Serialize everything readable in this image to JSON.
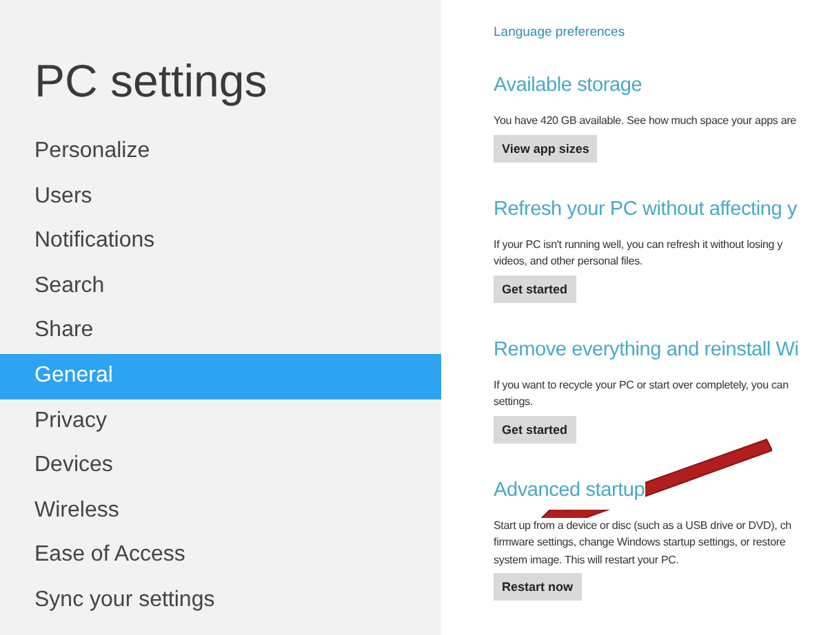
{
  "sidebar": {
    "title": "PC settings",
    "items": [
      {
        "label": "Personalize",
        "selected": false
      },
      {
        "label": "Users",
        "selected": false
      },
      {
        "label": "Notifications",
        "selected": false
      },
      {
        "label": "Search",
        "selected": false
      },
      {
        "label": "Share",
        "selected": false
      },
      {
        "label": "General",
        "selected": true
      },
      {
        "label": "Privacy",
        "selected": false
      },
      {
        "label": "Devices",
        "selected": false
      },
      {
        "label": "Wireless",
        "selected": false
      },
      {
        "label": "Ease of Access",
        "selected": false
      },
      {
        "label": "Sync your settings",
        "selected": false
      }
    ]
  },
  "content": {
    "top_link": "Language preferences",
    "sections": [
      {
        "heading": "Available storage",
        "lines": [
          "You have 420 GB available. See how much space your apps are"
        ],
        "button": "View app sizes"
      },
      {
        "heading": "Refresh your PC without affecting y",
        "lines": [
          "If your PC isn't running well, you can refresh it without losing y",
          "videos, and other personal files."
        ],
        "button": "Get started"
      },
      {
        "heading": "Remove everything and reinstall Wi",
        "lines": [
          "If you want to recycle your PC or start over completely, you can",
          "settings."
        ],
        "button": "Get started"
      },
      {
        "heading": "Advanced startup",
        "lines": [
          "Start up from a device or disc (such as a USB drive or DVD), ch",
          "firmware settings, change Windows startup settings, or restore",
          "system image. This will restart your PC."
        ],
        "button": "Restart now"
      }
    ]
  }
}
